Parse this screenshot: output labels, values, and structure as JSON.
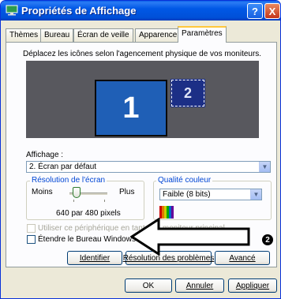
{
  "window": {
    "title": "Propriétés de Affichage",
    "help_btn": "?",
    "close_btn": "X"
  },
  "tabs": [
    {
      "label": "Thèmes"
    },
    {
      "label": "Bureau"
    },
    {
      "label": "Écran de veille"
    },
    {
      "label": "Apparence"
    },
    {
      "label": "Paramètres",
      "active": true
    }
  ],
  "settings": {
    "instruction": "Déplacez les icônes selon l'agencement physique de vos moniteurs.",
    "monitor_1": "1",
    "monitor_2": "2",
    "display_label": "Affichage :",
    "display_value": "2. Écran par défaut",
    "resolution_title": "Résolution de l'écran",
    "res_less": "Moins",
    "res_more": "Plus",
    "resolution_value": "640 par 480 pixels",
    "resolution_slider_position": 0.1,
    "color_title": "Qualité couleur",
    "color_value": "Faible (8 bits)",
    "primary_checkbox": "Utiliser ce périphérique en tant que moniteur principal",
    "primary_checkbox_visible": "Utiliser ce périphérique en tant que moniteur principal.",
    "extend_checkbox": "Étendre le Bureau Windows à ce moniteur",
    "identify_btn": "Identifier",
    "troubleshoot_btn": "Résolution des problèmes",
    "advanced_btn": "Avancé"
  },
  "footer": {
    "ok": "OK",
    "cancel": "Annuler",
    "apply": "Appliquer"
  },
  "annotation": {
    "badge": "2"
  },
  "colors": {
    "titlebar": "#0058e6",
    "monitor_primary": "#1f5fb6",
    "monitor_secondary": "#1c2f86",
    "monitor_area": "#58585e"
  }
}
